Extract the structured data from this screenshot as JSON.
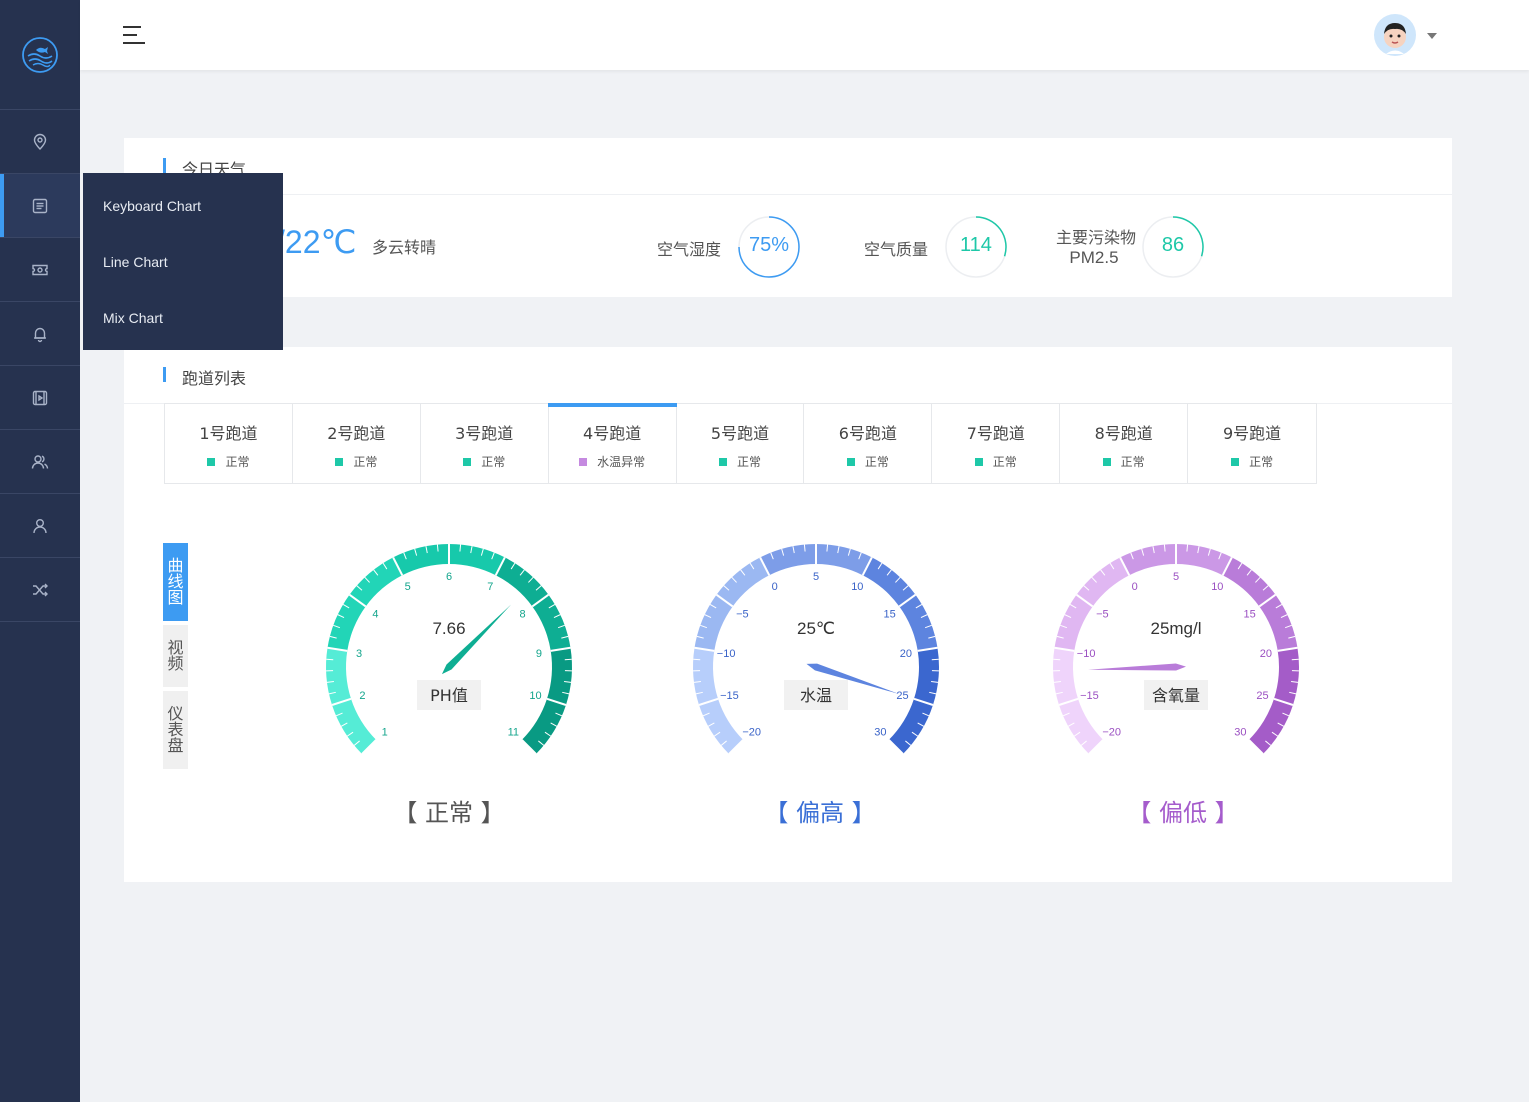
{
  "sidebar": {
    "logo_icon": "fish-wave-logo",
    "items": [
      {
        "icon": "location-pin-icon",
        "active": false
      },
      {
        "icon": "list-document-icon",
        "active": true
      },
      {
        "icon": "ticket-icon",
        "active": false
      },
      {
        "icon": "bell-icon",
        "active": false
      },
      {
        "icon": "video-play-icon",
        "active": false
      },
      {
        "icon": "users-group-icon",
        "active": false
      },
      {
        "icon": "user-icon",
        "active": false
      },
      {
        "icon": "shuffle-icon",
        "active": false
      }
    ]
  },
  "flyout": {
    "items": [
      "Keyboard Chart",
      "Line Chart",
      "Mix Chart"
    ]
  },
  "header": {
    "menu_icon": "hamburger-icon",
    "avatar_icon": "avatar",
    "dropdown_icon": "caret-down-icon"
  },
  "weather": {
    "title": "今日天气",
    "temperature": "/22℃",
    "condition": "多云转晴",
    "humidity_label": "空气湿度",
    "humidity_value": "75%",
    "humidity_fraction": 0.75,
    "quality_label": "空气质量",
    "quality_value": "114",
    "quality_fraction": 0.3,
    "pollutant_label": "主要污染物",
    "pollutant_name": "PM2.5",
    "pollutant_value": "86",
    "pollutant_fraction": 0.3,
    "colors": {
      "blue": "#3d9bf2",
      "teal": "#1ec8a8"
    }
  },
  "lanes": {
    "title": "跑道列表",
    "tabs": [
      {
        "name": "1号跑道",
        "status": "正常",
        "color": "#1ec8a8"
      },
      {
        "name": "2号跑道",
        "status": "正常",
        "color": "#1ec8a8"
      },
      {
        "name": "3号跑道",
        "status": "正常",
        "color": "#1ec8a8"
      },
      {
        "name": "4号跑道",
        "status": "水温异常",
        "color": "#c58ae0"
      },
      {
        "name": "5号跑道",
        "status": "正常",
        "color": "#1ec8a8"
      },
      {
        "name": "6号跑道",
        "status": "正常",
        "color": "#1ec8a8"
      },
      {
        "name": "7号跑道",
        "status": "正常",
        "color": "#1ec8a8"
      },
      {
        "name": "8号跑道",
        "status": "正常",
        "color": "#1ec8a8"
      },
      {
        "name": "9号跑道",
        "status": "正常",
        "color": "#1ec8a8"
      }
    ],
    "active_tab": 3,
    "view_tabs": [
      "曲线图",
      "视频",
      "仪表盘"
    ],
    "active_view": 0
  },
  "gauges": [
    {
      "label": "PH值",
      "value": 7.66,
      "display": "7.66",
      "min": 1,
      "max": 11,
      "ticks": [
        "1",
        "2",
        "3",
        "4",
        "5",
        "6",
        "7",
        "8",
        "9",
        "10",
        "11"
      ],
      "status": "【 正常 】",
      "status_color": "#555555",
      "colors": [
        "#55ecd6",
        "#22d5b7",
        "#17c9ab",
        "#0eae93",
        "#099a83"
      ],
      "label_color": "#13a58c"
    },
    {
      "label": "水温",
      "value": 25,
      "display": "25℃",
      "min": -20,
      "max": 30,
      "ticks": [
        "−20",
        "−15",
        "−10",
        "−5",
        "0",
        "5",
        "10",
        "15",
        "20",
        "25",
        "30"
      ],
      "status": "【 偏高 】",
      "status_color": "#3a6fd6",
      "colors": [
        "#b7cefb",
        "#9bb8f2",
        "#7d9de8",
        "#5d84df",
        "#3b67cf"
      ],
      "label_color": "#3a63c8"
    },
    {
      "label": "含氧量",
      "value": -12,
      "display": "25mg/l",
      "min": -20,
      "max": 30,
      "ticks": [
        "−20",
        "−15",
        "−10",
        "−5",
        "0",
        "5",
        "10",
        "15",
        "20",
        "25",
        "30"
      ],
      "status": "【 偏低 】",
      "status_color": "#a55ccc",
      "colors": [
        "#efd4fb",
        "#e0b7f2",
        "#cb98e6",
        "#b97cd9",
        "#a45cc8"
      ],
      "label_color": "#9b50c2"
    }
  ]
}
